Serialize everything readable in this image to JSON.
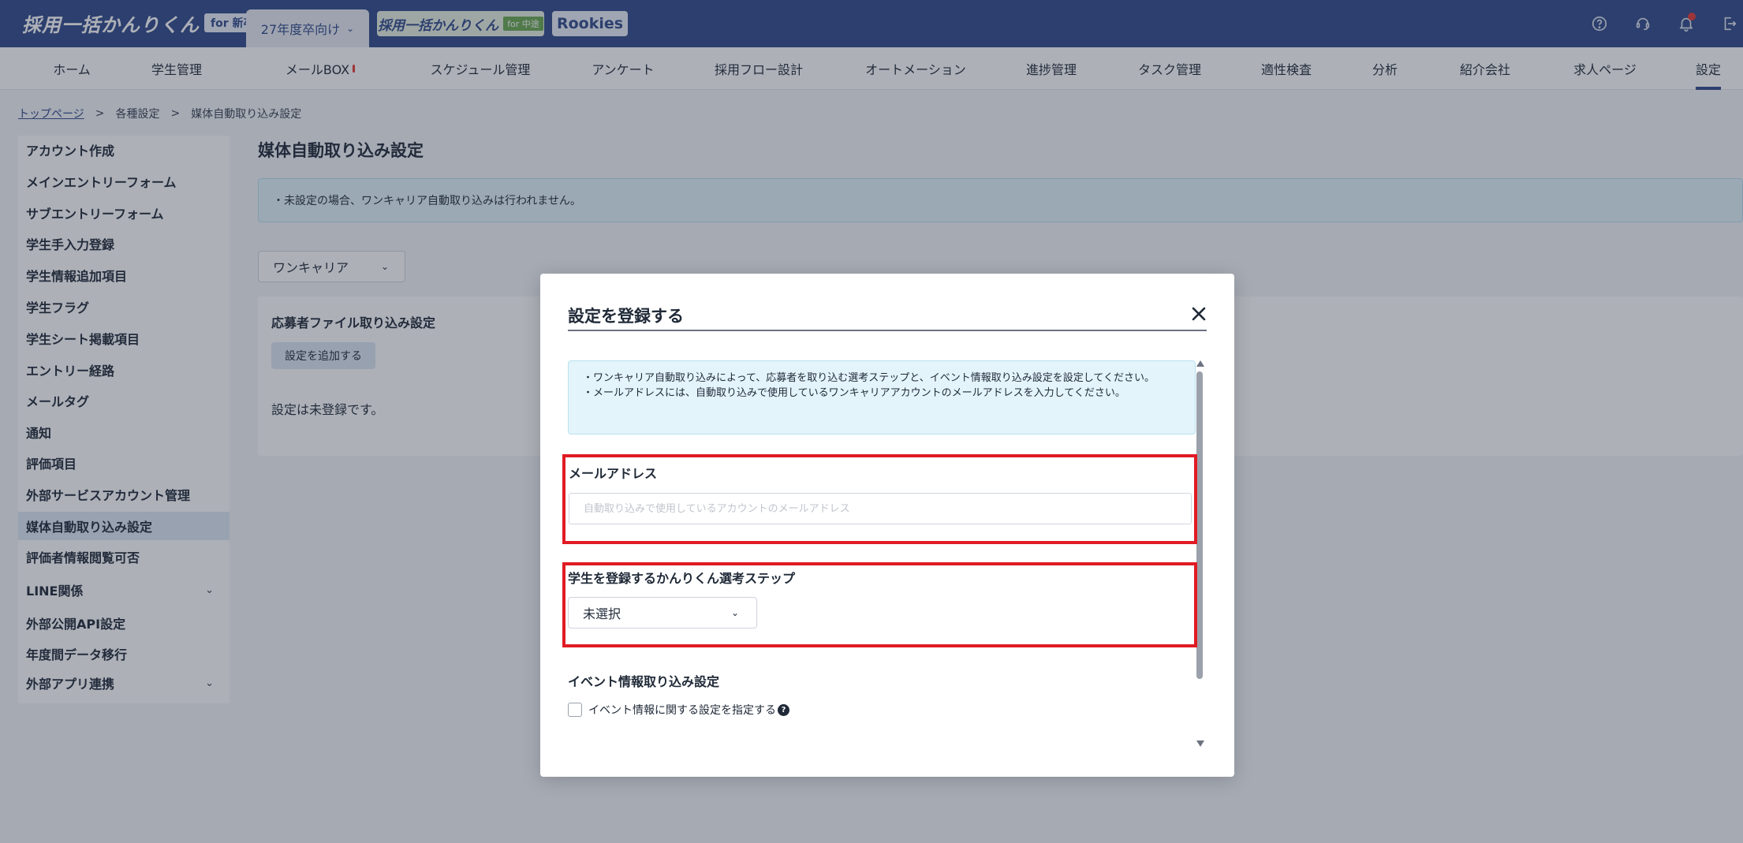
{
  "header": {
    "logo_text": "採用一括かんりくん",
    "logo_badge": "for 新卒",
    "year_selector": "27年度卒向け",
    "logo_chuuto_text": "採用一括かんりくん",
    "logo_chuuto_tag": "for 中途",
    "logo_rookies": "Rookies",
    "icons": [
      "help-icon",
      "support-icon",
      "bell-icon",
      "logout-icon"
    ]
  },
  "nav": {
    "items": [
      "ホーム",
      "学生管理",
      "メールBOX",
      "スケジュール管理",
      "アンケート",
      "採用フロー設計",
      "オートメーション",
      "進捗管理",
      "タスク管理",
      "適性検査",
      "分析",
      "紹介会社",
      "求人ページ",
      "設定"
    ],
    "active": "設定"
  },
  "breadcrumb": {
    "items": [
      "トップページ",
      "各種設定",
      "媒体自動取り込み設定"
    ],
    "separator": ">"
  },
  "sidebar": {
    "items": [
      "アカウント作成",
      "メインエントリーフォーム",
      "サブエントリーフォーム",
      "学生手入力登録",
      "学生情報追加項目",
      "学生フラグ",
      "学生シート掲載項目",
      "エントリー経路",
      "メールタグ",
      "通知",
      "評価項目",
      "外部サービスアカウント管理",
      "媒体自動取り込み設定",
      "評価者情報閲覧可否",
      "LINE関係",
      "外部公開API設定",
      "年度間データ移行",
      "外部アプリ連携"
    ],
    "active": "媒体自動取り込み設定"
  },
  "main": {
    "title": "媒体自動取り込み設定",
    "info": "・未設定の場合、ワンキャリア自動取り込みは行われません。",
    "media_select": "ワンキャリア",
    "panel_title": "応募者ファイル取り込み設定",
    "add_button": "設定を追加する",
    "empty_text": "設定は未登録です。"
  },
  "modal": {
    "title": "設定を登録する",
    "info_line1": "・ワンキャリア自動取り込みによって、応募者を取り込む選考ステップと、イベント情報取り込み設定を設定してください。",
    "info_line2": "・メールアドレスには、自動取り込みで使用しているワンキャリアアカウントのメールアドレスを入力してください。",
    "email_label": "メールアドレス",
    "email_value": "",
    "email_placeholder": "自動取り込みで使用しているアカウントのメールアドレス",
    "step_label": "学生を登録するかんりくん選考ステップ",
    "step_value": "未選択",
    "event_label": "イベント情報取り込み設定",
    "event_checkbox": "イベント情報に関する設定を指定する",
    "event_checked": false
  },
  "colors": {
    "header": "#2f4a8a",
    "highlight": "#e01b24",
    "info_bg": "#e3f4fb"
  }
}
